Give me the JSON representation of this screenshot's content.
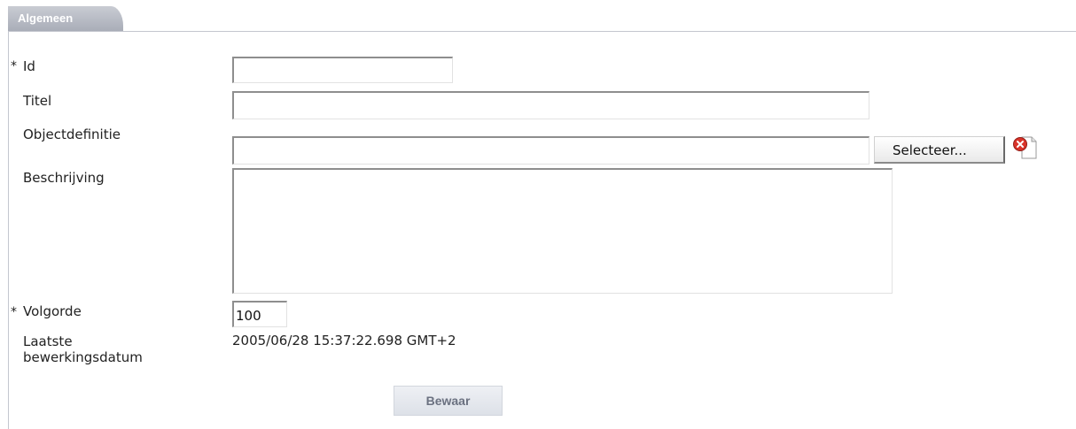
{
  "tab": {
    "label": "Algemeen"
  },
  "form": {
    "required_marker": "*",
    "id": {
      "label": "Id",
      "value": ""
    },
    "titel": {
      "label": "Titel",
      "value": ""
    },
    "objectdefinitie": {
      "label": "Objectdefinitie",
      "value": "",
      "select_label": "Selecteer..."
    },
    "beschrijving": {
      "label": "Beschrijving",
      "value": ""
    },
    "volgorde": {
      "label": "Volgorde",
      "value": "100"
    },
    "laatste": {
      "label_line1": "Laatste",
      "label_line2": "bewerkingsdatum",
      "value": "2005/06/28 15:37:22.698 GMT+2"
    }
  },
  "actions": {
    "save_label": "Bewaar"
  },
  "colors": {
    "tab_bg": "#b5b9c3",
    "clear_icon": "#d9342b"
  },
  "icons": {
    "clear": "clear-icon"
  }
}
